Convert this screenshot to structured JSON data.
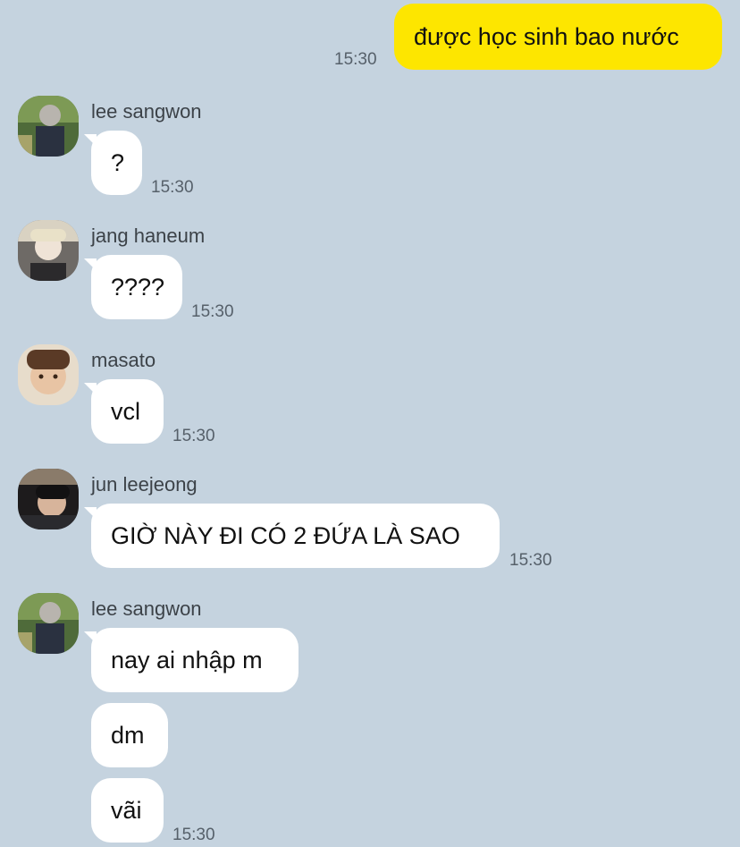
{
  "chat": {
    "outgoing": {
      "text": "được học sinh bao nước",
      "time": "15:30",
      "bubble_color": "#fde600"
    },
    "groups": [
      {
        "sender": "lee sangwon",
        "avatar_icon": "profile-photo-icon",
        "messages": [
          "?"
        ],
        "time": "15:30"
      },
      {
        "sender": "jang haneum",
        "avatar_icon": "profile-photo-icon",
        "messages": [
          "????"
        ],
        "time": "15:30"
      },
      {
        "sender": "masato",
        "avatar_icon": "profile-photo-icon",
        "messages": [
          "vcl"
        ],
        "time": "15:30"
      },
      {
        "sender": "jun leejeong",
        "avatar_icon": "profile-photo-icon",
        "messages": [
          "GIỜ NÀY ĐI CÓ 2 ĐỨA LÀ SAO"
        ],
        "time": "15:30"
      },
      {
        "sender": "lee sangwon",
        "avatar_icon": "profile-photo-icon",
        "messages": [
          "nay ai nhập m",
          "dm",
          "vãi"
        ],
        "time": "15:30"
      }
    ],
    "background_color": "#c5d3df",
    "incoming_bubble_color": "#ffffff"
  }
}
